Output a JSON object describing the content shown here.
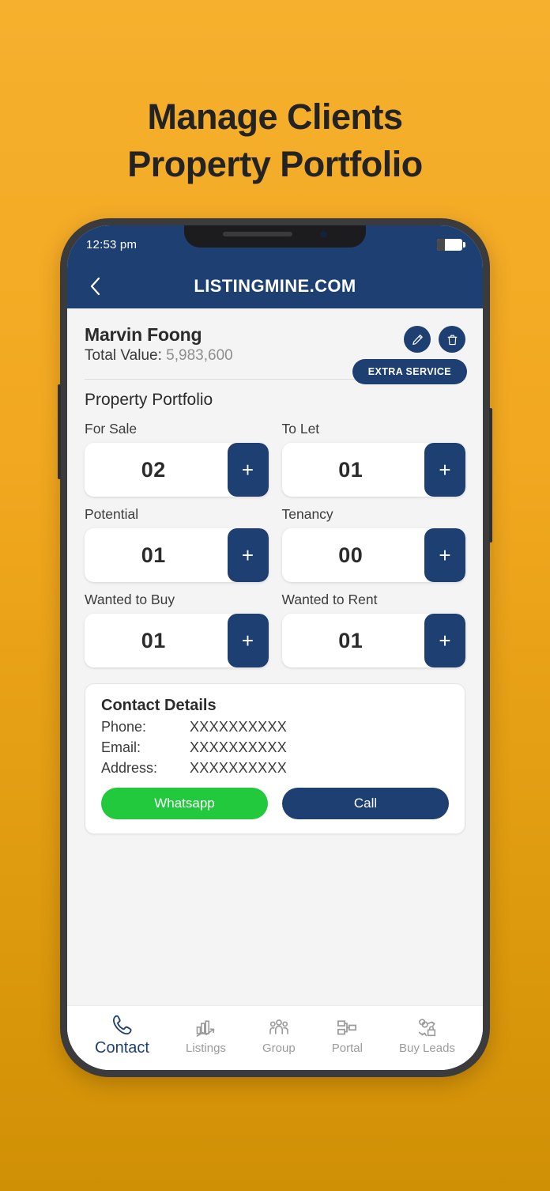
{
  "headline": {
    "line1": "Manage Clients",
    "line2": "Property Portfolio"
  },
  "colors": {
    "brand_blue": "#1e3f72",
    "background_orange_top": "#f6b02d",
    "background_orange_bottom": "#d09005",
    "whatsapp_green": "#22c93c",
    "screen_gray": "#f4f4f4"
  },
  "statusbar": {
    "time": "12:53 pm"
  },
  "appbar": {
    "title": "LISTINGMINE.COM",
    "back_icon": "chevron-left-icon"
  },
  "client": {
    "name": "Marvin Foong",
    "value_label": "Total Value:",
    "value_amount": "5,983,600",
    "edit_icon": "pencil-icon",
    "delete_icon": "trash-icon",
    "extra_service_label": "EXTRA SERVICE"
  },
  "portfolio": {
    "section_title": "Property Portfolio",
    "plus_label": "+",
    "counters": [
      {
        "label": "For Sale",
        "value": "02"
      },
      {
        "label": "To Let",
        "value": "01"
      },
      {
        "label": "Potential",
        "value": "01"
      },
      {
        "label": "Tenancy",
        "value": "00"
      },
      {
        "label": "Wanted to Buy",
        "value": "01"
      },
      {
        "label": "Wanted to Rent",
        "value": "01"
      }
    ]
  },
  "contact": {
    "title": "Contact Details",
    "rows": [
      {
        "key": "Phone:",
        "value": "XXXXXXXXXX"
      },
      {
        "key": "Email:",
        "value": "XXXXXXXXXX"
      },
      {
        "key": "Address:",
        "value": "XXXXXXXXXX"
      }
    ],
    "whatsapp_label": "Whatsapp",
    "call_label": "Call"
  },
  "bottom_nav": {
    "items": [
      {
        "label": "Contact",
        "icon": "phone-icon",
        "active": true
      },
      {
        "label": "Listings",
        "icon": "buildings-chart-icon",
        "active": false
      },
      {
        "label": "Group",
        "icon": "people-group-icon",
        "active": false
      },
      {
        "label": "Portal",
        "icon": "sitemap-icon",
        "active": false
      },
      {
        "label": "Buy Leads",
        "icon": "coins-exchange-icon",
        "active": false
      }
    ]
  }
}
